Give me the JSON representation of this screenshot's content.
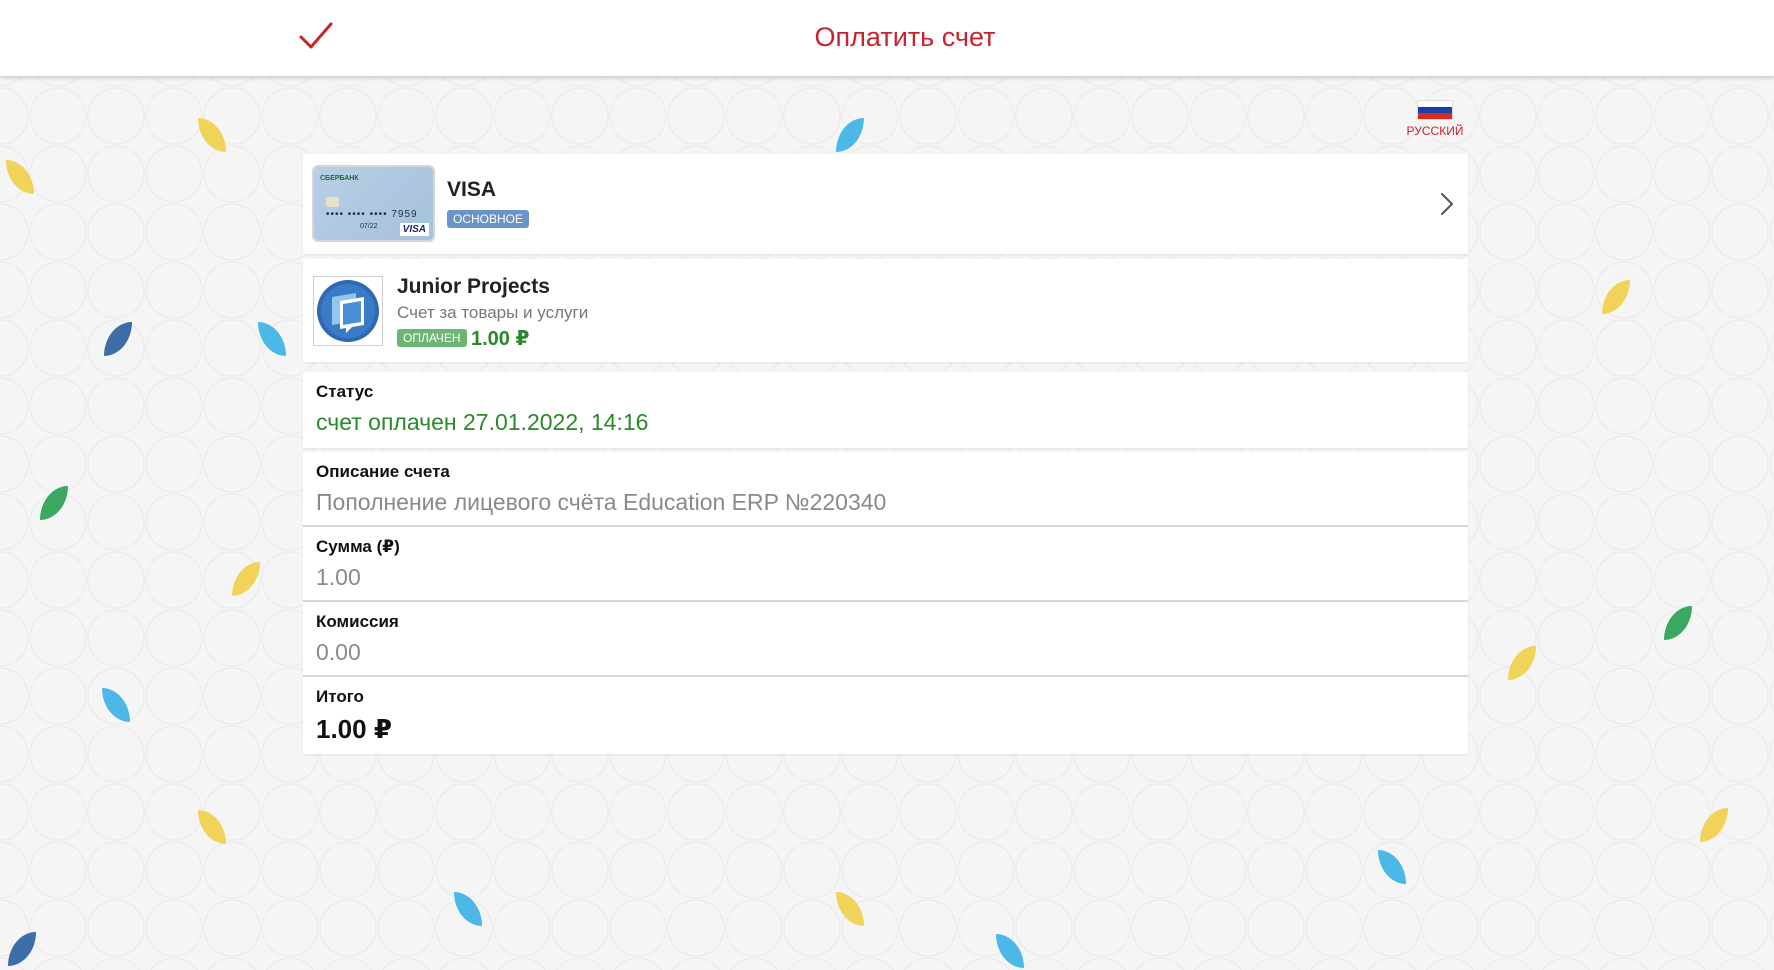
{
  "header": {
    "title": "Оплатить счет",
    "confirm_icon": "checkmark-icon",
    "accent_color": "#c8232c"
  },
  "language": {
    "label": "РУССКИЙ",
    "flag_icon": "russia-flag-icon"
  },
  "payment_card": {
    "name": "VISA",
    "badge": "ОСНОВНОЕ",
    "image": {
      "bank": "СБЕРБАНК",
      "number_masked": "•••• •••• •••• 7959",
      "expiry": "07/22",
      "brand": "VISA"
    },
    "chevron_icon": "chevron-right-icon"
  },
  "merchant": {
    "name": "Junior Projects",
    "subtitle": "Счет за товары и услуги",
    "status_badge": "ОПЛАЧЕН",
    "amount": "1.00 ₽",
    "logo_icon": "junior-projects-logo"
  },
  "status": {
    "label": "Статус",
    "value": "счет оплачен 27.01.2022, 14:16",
    "color": "#2a8a2a"
  },
  "details": {
    "description_label": "Описание счета",
    "description_value": "Пополнение лицевого счёта Education ERP №220340",
    "amount_label": "Сумма (₽)",
    "amount_value": "1.00",
    "commission_label": "Комиссия",
    "commission_value": "0.00",
    "total_label": "Итого",
    "total_value": "1.00 ₽"
  }
}
